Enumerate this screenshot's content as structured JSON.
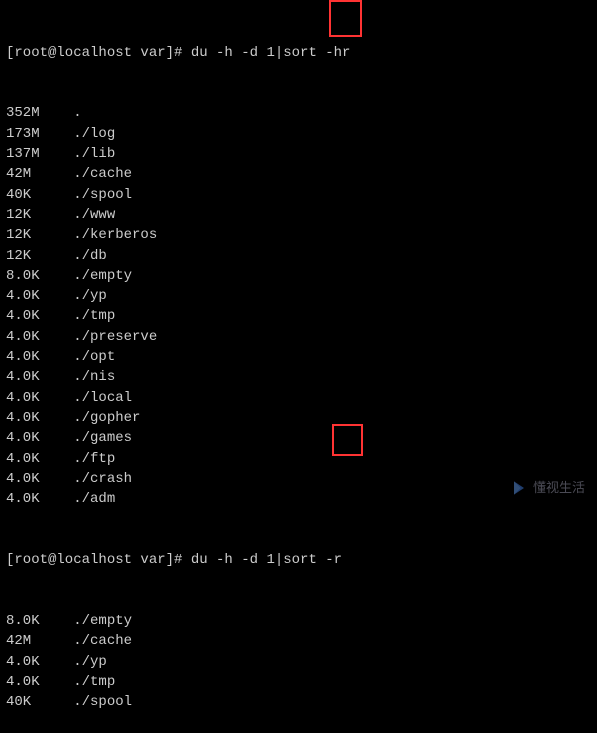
{
  "prompt1": "[root@localhost var]# du -h -d 1|sort -hr",
  "prompt2": "[root@localhost var]# du -h -d 1|sort -r",
  "output1": [
    {
      "size": "352M",
      "path": "."
    },
    {
      "size": "173M",
      "path": "./log"
    },
    {
      "size": "137M",
      "path": "./lib"
    },
    {
      "size": "42M",
      "path": "./cache"
    },
    {
      "size": "40K",
      "path": "./spool"
    },
    {
      "size": "12K",
      "path": "./www"
    },
    {
      "size": "12K",
      "path": "./kerberos"
    },
    {
      "size": "12K",
      "path": "./db"
    },
    {
      "size": "8.0K",
      "path": "./empty"
    },
    {
      "size": "4.0K",
      "path": "./yp"
    },
    {
      "size": "4.0K",
      "path": "./tmp"
    },
    {
      "size": "4.0K",
      "path": "./preserve"
    },
    {
      "size": "4.0K",
      "path": "./opt"
    },
    {
      "size": "4.0K",
      "path": "./nis"
    },
    {
      "size": "4.0K",
      "path": "./local"
    },
    {
      "size": "4.0K",
      "path": "./gopher"
    },
    {
      "size": "4.0K",
      "path": "./games"
    },
    {
      "size": "4.0K",
      "path": "./ftp"
    },
    {
      "size": "4.0K",
      "path": "./crash"
    },
    {
      "size": "4.0K",
      "path": "./adm"
    }
  ],
  "output2": [
    {
      "size": "8.0K",
      "path": "./empty"
    },
    {
      "size": "42M",
      "path": "./cache"
    },
    {
      "size": "4.0K",
      "path": "./yp"
    },
    {
      "size": "4.0K",
      "path": "./tmp"
    },
    {
      "size": "40K",
      "path": "./spool"
    }
  ],
  "watermark": {
    "text": "懂视生活",
    "sub": ""
  }
}
